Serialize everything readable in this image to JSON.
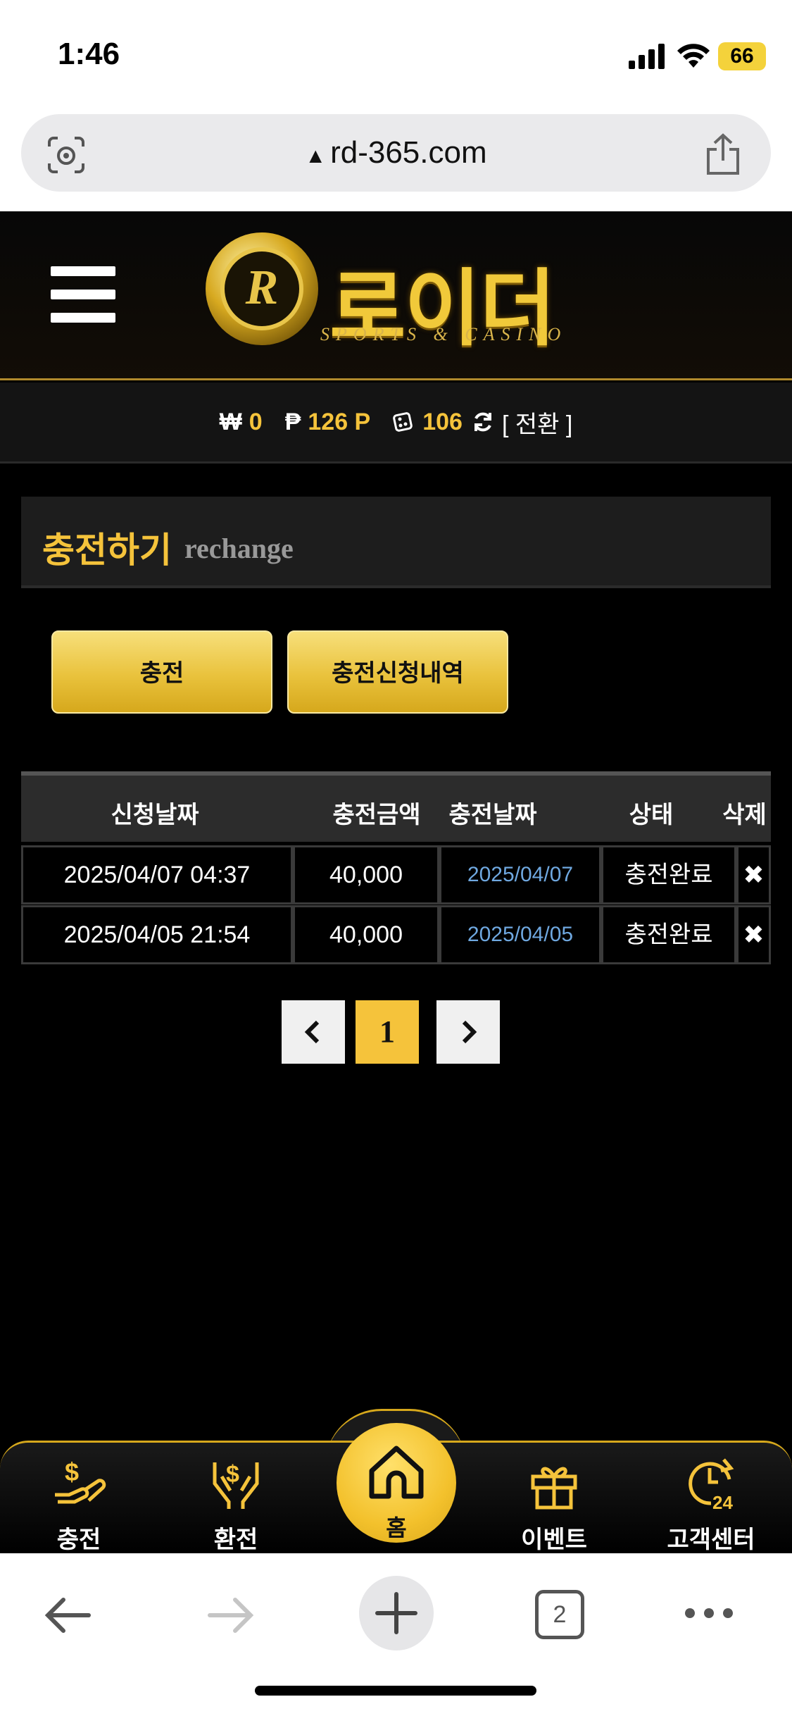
{
  "status": {
    "time": "1:46",
    "battery": "66"
  },
  "browser": {
    "url": "rd-365.com",
    "tabs_count": "2"
  },
  "header": {
    "logo_letter": "R",
    "logo_name": "로이더",
    "logo_sub": "SPORTS & CASINO"
  },
  "balance": {
    "won_symbol": "₩",
    "won": "0",
    "point_symbol": "₱",
    "point": "126 P",
    "coupon": "106",
    "convert": "[ 전환 ]"
  },
  "section": {
    "title_ko": "충전하기",
    "title_en": "rechange"
  },
  "buttons": {
    "charge": "충전",
    "history": "충전신청내역"
  },
  "table": {
    "headers": [
      "신청날짜",
      "충전금액",
      "충전날짜",
      "상태",
      "삭제"
    ],
    "rows": [
      {
        "requested": "2025/04/07 04:37",
        "amount": "40,000",
        "charged": "2025/04/07",
        "status": "충전완료",
        "delete": "✖"
      },
      {
        "requested": "2025/04/05 21:54",
        "amount": "40,000",
        "charged": "2025/04/05",
        "status": "충전완료",
        "delete": "✖"
      }
    ]
  },
  "pagination": {
    "prev": "‹",
    "current": "1",
    "next": "›"
  },
  "bottom_nav": {
    "charge": "충전",
    "exchange": "환전",
    "home": "홈",
    "event": "이벤트",
    "support": "고객센터"
  },
  "colors": {
    "gold": "#f5c33b",
    "link_blue": "#6fa8e0"
  }
}
